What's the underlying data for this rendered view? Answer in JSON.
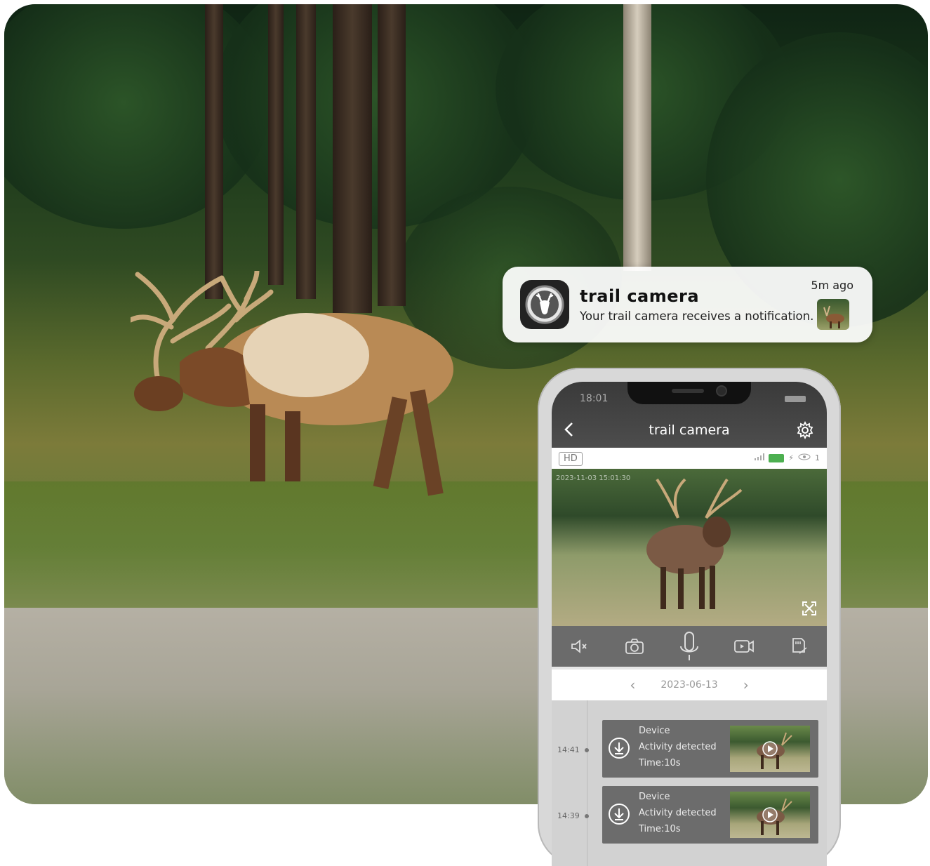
{
  "notification": {
    "app_name": "trail camera",
    "message": "Your trail camera receives a notification.",
    "time_ago": "5m ago",
    "icon": "deer-head-icon"
  },
  "phone": {
    "status_time": "18:01",
    "header": {
      "title": "trail camera",
      "back_icon": "back-chevron-icon",
      "settings_icon": "gear-icon"
    },
    "info_bar": {
      "quality": "HD",
      "viewer_count": "1"
    },
    "live_view": {
      "timestamp": "2023-11-03 15:01:30"
    },
    "controls": [
      "mute-icon",
      "snapshot-icon",
      "microphone-icon",
      "record-icon",
      "sd-card-icon"
    ],
    "date_selector": {
      "date": "2023-06-13",
      "prev": "‹",
      "next": "›"
    },
    "events": [
      {
        "time": "14:41",
        "source": "Device",
        "type": "Activity detected",
        "duration": "Time:10s"
      },
      {
        "time": "14:39",
        "source": "Device",
        "type": "Activity detected",
        "duration": "Time:10s"
      }
    ]
  },
  "colors": {
    "notification_bg": "#f2f2f2",
    "app_header": "#444444",
    "controls_bar": "#6b6b6b",
    "event_card": "#6c6c6c",
    "battery": "#4caf50"
  }
}
